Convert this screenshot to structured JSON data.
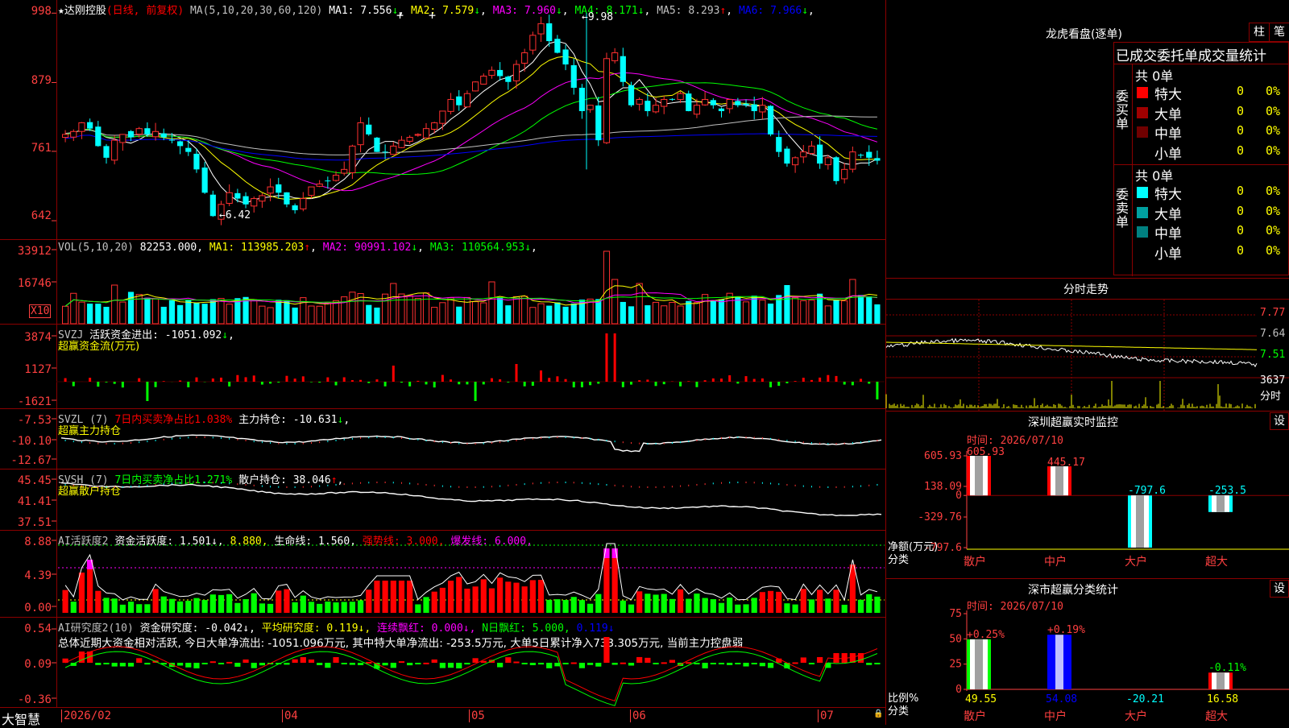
{
  "main": {
    "star": "★",
    "name": "达刚控股",
    "mode": "(日线, 前复权)",
    "ma_label": "MA(5,10,20,30,60,120)",
    "ma": [
      {
        "label": "MA1:",
        "value": "7.556",
        "arrow": "↓",
        "color": "#ffffff"
      },
      {
        "label": "MA2:",
        "value": "7.579",
        "arrow": "↓",
        "color": "#ffff00"
      },
      {
        "label": "MA3:",
        "value": "7.960",
        "arrow": "↓",
        "color": "#ff00ff"
      },
      {
        "label": "MA4:",
        "value": "8.171",
        "arrow": "↓",
        "color": "#00ff00"
      },
      {
        "label": "MA5:",
        "value": "8.293",
        "arrow": "↑",
        "color": "#c0c0c0"
      },
      {
        "label": "MA6:",
        "value": "7.966",
        "arrow": "↓",
        "color": "#0000ff"
      }
    ],
    "y_labels": [
      "998",
      "879",
      "761",
      "642"
    ],
    "max_note": "9.98",
    "min_note": "6.42",
    "up_markers": [
      "+",
      "+"
    ]
  },
  "vol": {
    "title": "VOL(5,10,20)",
    "value": "82253.000",
    "ma": [
      {
        "label": "MA1:",
        "value": "113985.203",
        "arrow": "↑",
        "color": "#ffff00"
      },
      {
        "label": "MA2:",
        "value": "90991.102",
        "arrow": "↓",
        "color": "#ff00ff"
      },
      {
        "label": "MA3:",
        "value": "110564.953",
        "arrow": "↓",
        "color": "#00ff00"
      }
    ],
    "y_labels": [
      "33912",
      "16746"
    ],
    "unit": "X10"
  },
  "svzj": {
    "title": "SVZJ",
    "label": "活跃资金进出:",
    "value": "-1051.092",
    "arrow": "↓",
    "sub": "超赢资金流(万元)",
    "y_labels": [
      "3874",
      "1127",
      "-1621"
    ]
  },
  "svzl": {
    "title": "SVZL (7)",
    "ratio_label": "7日内买卖净占比1.038%",
    "hold_label": "主力持仓:",
    "value": "-10.631",
    "arrow": "↓",
    "sub": "超赢主力持仓",
    "y_labels": [
      "-7.53",
      "-10.10",
      "-12.67"
    ]
  },
  "svsh": {
    "title": "SVSH (7)",
    "ratio_label": "7日内买卖净占比1.271%",
    "hold_label": "散户持仓:",
    "value": "38.046",
    "arrow": "↑",
    "sub": "超赢散户持仓",
    "y_labels": [
      "45.45",
      "41.41",
      "37.51"
    ]
  },
  "ai1": {
    "title": "AI活跃度2",
    "items": [
      {
        "text": "资金活跃度: 1.501↓,",
        "color": "#ffffff"
      },
      {
        "text": "8.880,",
        "color": "#ffff00"
      },
      {
        "text": "生命线: 1.560,",
        "color": "#ffffff"
      },
      {
        "text": "强势线: 3.000,",
        "color": "#ff0000"
      },
      {
        "text": "爆发线: 6.000,",
        "color": "#ff00ff"
      }
    ],
    "y_labels": [
      "8.88",
      "4.39",
      "0.00"
    ]
  },
  "ai2": {
    "title": "AI研究度2(10)",
    "items": [
      {
        "text": "资金研究度: -0.042↓,",
        "color": "#ffffff"
      },
      {
        "text": "平均研究度: 0.119↓,",
        "color": "#ffff00"
      },
      {
        "text": "连续飘红: 0.000↓,",
        "color": "#ff00ff"
      },
      {
        "text": "N日飘红: 5.000,",
        "color": "#00ff00"
      },
      {
        "text": "0.119↓",
        "color": "#0000ff"
      }
    ],
    "summary": "总体近期大资金相对活跃, 今日大单净流出: -1051.096万元, 其中特大单净流出: -253.5万元, 大单5日累计净入733.305万元, 当前主力控盘弱",
    "y_labels": [
      "0.54",
      "0.09",
      "-0.36"
    ]
  },
  "bottom": {
    "brand": "大智慧",
    "dates": [
      "2026/02",
      "04",
      "05",
      "06",
      "07"
    ],
    "lock": "🔒"
  },
  "dragon": {
    "title": "龙虎看盘(逐单)",
    "btn1": "柱",
    "btn2": "笔",
    "header": "已成交委托单成交量统计",
    "buy_total": "共 0单",
    "sell_total": "共 0单",
    "buy_label": "委买单",
    "sell_label": "委卖单",
    "buy_rows": [
      {
        "name": "特大",
        "count": "0",
        "pct": "0%",
        "color": "#ff0000"
      },
      {
        "name": "大单",
        "count": "0",
        "pct": "0%",
        "color": "#a00000"
      },
      {
        "name": "中单",
        "count": "0",
        "pct": "0%",
        "color": "#700000"
      },
      {
        "name": "小单",
        "count": "0",
        "pct": "0%",
        "color": ""
      }
    ],
    "sell_rows": [
      {
        "name": "特大",
        "count": "0",
        "pct": "0%",
        "color": "#00ffff"
      },
      {
        "name": "大单",
        "count": "0",
        "pct": "0%",
        "color": "#00a0a0"
      },
      {
        "name": "中单",
        "count": "0",
        "pct": "0%",
        "color": "#008080"
      },
      {
        "name": "小单",
        "count": "0",
        "pct": "0%",
        "color": ""
      }
    ]
  },
  "intraday": {
    "title": "分时走势",
    "price_labels": [
      "7.77",
      "7.64",
      "7.51"
    ],
    "vol_label": "3637",
    "vol_unit": "分时"
  },
  "sz_monitor": {
    "title": "深圳超赢实时监控",
    "set": "设",
    "time": "时间: 2026/07/10",
    "y_labels": [
      "605.93",
      "138.09",
      "0",
      "-329.76",
      "-797.6"
    ],
    "ylabel1": "净额(万元)",
    "ylabel2": "分类",
    "categories": [
      "散户",
      "中户",
      "大户",
      "超大"
    ],
    "values": [
      605.93,
      445.17,
      -797.6,
      -253.5
    ],
    "value_labels": [
      "605.93",
      "445.17",
      "-797.6",
      "-253.5"
    ]
  },
  "sz_class": {
    "title": "深市超赢分类统计",
    "set": "设",
    "time": "时间: 2026/07/10",
    "y_labels": [
      "75",
      "50",
      "25",
      "0"
    ],
    "ylabel1": "比例%",
    "ylabel2": "分类",
    "categories": [
      "散户",
      "中户",
      "大户",
      "超大"
    ],
    "values": [
      49.55,
      54.08,
      -20.21,
      16.58
    ],
    "value_labels": [
      "49.55",
      "54.08",
      "-20.21",
      "16.58"
    ],
    "change_labels": [
      "+0.25%",
      "+0.19%",
      "",
      "-0.11%"
    ]
  },
  "chart_data": [
    {
      "type": "candlestick",
      "title": "达刚控股 (日线, 前复权)",
      "x_range": [
        "2026/02",
        "2026/07"
      ],
      "ylim": [
        6.42,
        9.98
      ],
      "y_ticks": [
        9.98,
        8.79,
        7.61,
        6.42
      ],
      "close_series": [
        7.9,
        7.95,
        8.1,
        8.0,
        7.7,
        7.5,
        7.8,
        7.9,
        7.85,
        8.0,
        7.9,
        7.95,
        7.85,
        7.8,
        7.7,
        7.6,
        7.3,
        6.9,
        6.5,
        6.7,
        6.9,
        6.8,
        6.7,
        6.8,
        6.85,
        7.0,
        6.9,
        6.7,
        6.6,
        6.8,
        7.0,
        7.05,
        7.1,
        7.2,
        7.3,
        7.7,
        8.1,
        7.9,
        7.6,
        7.6,
        7.7,
        7.8,
        7.85,
        7.9,
        8.0,
        8.1,
        8.3,
        8.5,
        8.4,
        8.6,
        8.8,
        8.9,
        9.0,
        8.9,
        8.8,
        9.1,
        9.3,
        9.6,
        9.8,
        9.5,
        9.3,
        9.1,
        8.7,
        8.3,
        8.4,
        7.8,
        9.2,
        9.3,
        8.8,
        8.4,
        8.5,
        8.3,
        8.4,
        8.5,
        8.5,
        8.6,
        8.3,
        8.4,
        8.5,
        8.4,
        8.3,
        8.5,
        8.4,
        8.4,
        8.3,
        8.4,
        7.9,
        7.6,
        7.4,
        7.5,
        7.6,
        7.7,
        7.4,
        7.5,
        7.1,
        7.3,
        7.6,
        7.55,
        7.5,
        7.45
      ],
      "ma": [
        {
          "name": "MA1",
          "value": 7.556
        },
        {
          "name": "MA2",
          "value": 7.579
        },
        {
          "name": "MA3",
          "value": 7.96
        },
        {
          "name": "MA4",
          "value": 8.171
        },
        {
          "name": "MA5",
          "value": 8.293
        },
        {
          "name": "MA6",
          "value": 7.966
        }
      ],
      "annotations": [
        {
          "text": "9.98",
          "type": "max"
        },
        {
          "text": "6.42",
          "type": "min"
        }
      ]
    },
    {
      "type": "bar",
      "title": "VOL(5,10,20)",
      "unit": "X10",
      "y_ticks": [
        33912,
        16746
      ],
      "last": 82253.0,
      "ma": [
        {
          "name": "MA1",
          "value": 113985.203
        },
        {
          "name": "MA2",
          "value": 90991.102
        },
        {
          "name": "MA3",
          "value": 110564.953
        }
      ]
    },
    {
      "type": "bar",
      "title": "SVZJ 活跃资金进出",
      "ylabel": "超赢资金流(万元)",
      "y_ticks": [
        3874,
        1127,
        -1621
      ],
      "last": -1051.092
    },
    {
      "type": "line",
      "title": "SVZL (7) 主力持仓",
      "y_ticks": [
        -7.53,
        -10.1,
        -12.67
      ],
      "last": -10.631
    },
    {
      "type": "line",
      "title": "SVSH (7) 散户持仓",
      "y_ticks": [
        45.45,
        41.41,
        37.51
      ],
      "last": 38.046
    },
    {
      "type": "bar",
      "title": "AI活跃度2",
      "y_ticks": [
        8.88,
        4.39,
        0.0
      ],
      "lines": {
        "生命线": 1.56,
        "强势线": 3.0,
        "爆发线": 6.0
      },
      "last": 1.501
    },
    {
      "type": "bar",
      "title": "AI研究度2(10)",
      "y_ticks": [
        0.54,
        0.09,
        -0.36
      ],
      "last": -0.042,
      "average": 0.119
    },
    {
      "type": "bar",
      "title": "深圳超赢实时监控",
      "categories": [
        "散户",
        "中户",
        "大户",
        "超大"
      ],
      "values": [
        605.93,
        445.17,
        -797.6,
        -253.5
      ],
      "ylabel": "净额(万元)",
      "ylim": [
        -797.6,
        605.93
      ]
    },
    {
      "type": "bar",
      "title": "深市超赢分类统计",
      "categories": [
        "散户",
        "中户",
        "大户",
        "超大"
      ],
      "values": [
        49.55,
        54.08,
        -20.21,
        16.58
      ],
      "changes": [
        "+0.25%",
        "+0.19%",
        "",
        "-0.11%"
      ],
      "ylabel": "比例%",
      "ylim": [
        0,
        75
      ]
    }
  ]
}
